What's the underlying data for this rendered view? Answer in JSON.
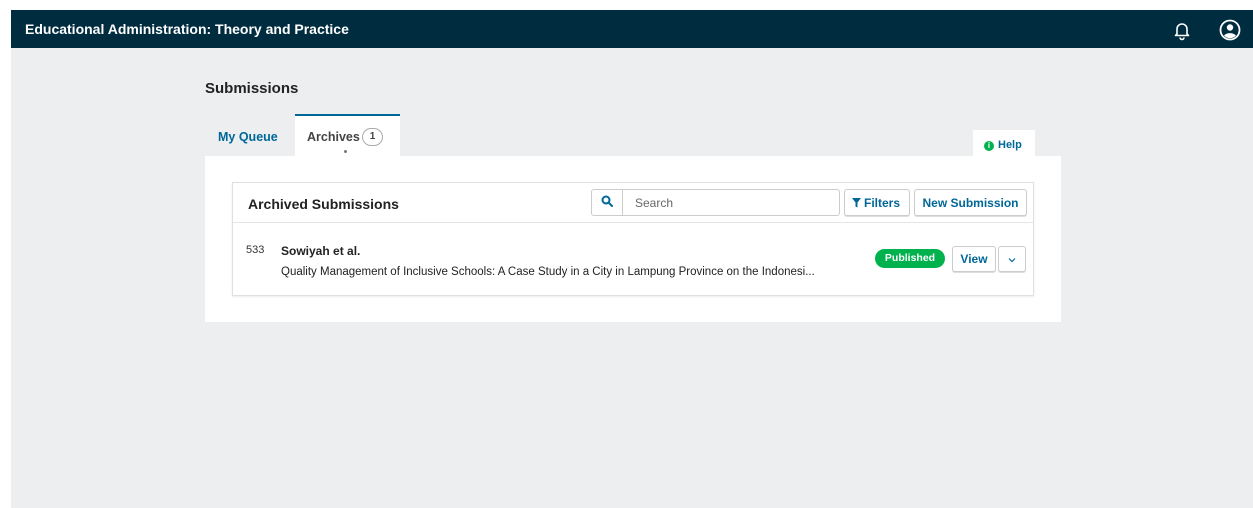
{
  "app": {
    "title": "Educational Administration: Theory and Practice"
  },
  "page": {
    "title": "Submissions"
  },
  "tabs": [
    {
      "label": "My Queue",
      "active": false
    },
    {
      "label": "Archives",
      "count": "1",
      "active": true
    }
  ],
  "help": {
    "label": "Help"
  },
  "list": {
    "title": "Archived Submissions",
    "search": {
      "placeholder": "Search",
      "value": ""
    },
    "filters_label": "Filters",
    "new_submission_label": "New Submission",
    "items": [
      {
        "id": "533",
        "author": "Sowiyah et al.",
        "title": "Quality Management of Inclusive Schools: A Case Study in a City in Lampung Province on the Indonesi...",
        "status": "Published",
        "view_label": "View"
      }
    ]
  },
  "colors": {
    "topbar": "#002c40",
    "accent": "#006798",
    "published": "#00b24e",
    "background": "#eceef0"
  },
  "icons": [
    "bell-icon",
    "user-circle-icon",
    "search-icon",
    "filter-icon",
    "info-icon",
    "chevron-down-icon"
  ]
}
